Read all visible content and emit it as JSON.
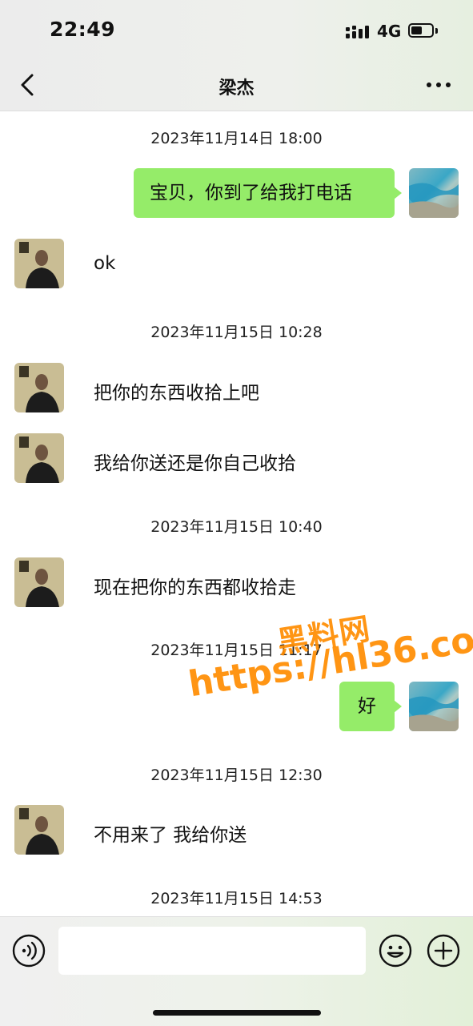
{
  "status_bar": {
    "time": "22:49",
    "network": "4G",
    "battery_level": 0.55
  },
  "header": {
    "title": "梁杰",
    "back_icon": "chevron-left-icon",
    "more_icon": "more-dots-icon"
  },
  "chat": {
    "timestamps": [
      "2023年11月14日 18:00",
      "2023年11月15日 10:28",
      "2023年11月15日 10:40",
      "2023年11月15日 11:17",
      "2023年11月15日 12:30",
      "2023年11月15日 14:53"
    ],
    "messages": [
      {
        "sender": "self",
        "text": "宝贝，你到了给我打电话"
      },
      {
        "sender": "contact",
        "text": "ok"
      },
      {
        "sender": "contact",
        "text": " 把你的东西收拾上吧"
      },
      {
        "sender": "contact",
        "text": "我给你送还是你自己收拾"
      },
      {
        "sender": "contact",
        "text": "现在把你的东西都收拾走"
      },
      {
        "sender": "self",
        "text": "好"
      },
      {
        "sender": "contact",
        "text": "不用来了 我给你送"
      }
    ]
  },
  "watermark": {
    "line1": "黑料网",
    "line2": "https://hl36.co"
  },
  "input_bar": {
    "placeholder": "",
    "voice_icon": "voice-icon",
    "emoji_icon": "emoji-icon",
    "plus_icon": "plus-icon"
  },
  "colors": {
    "outgoing_bubble": "#95ec69",
    "watermark": "#ff8c00"
  }
}
